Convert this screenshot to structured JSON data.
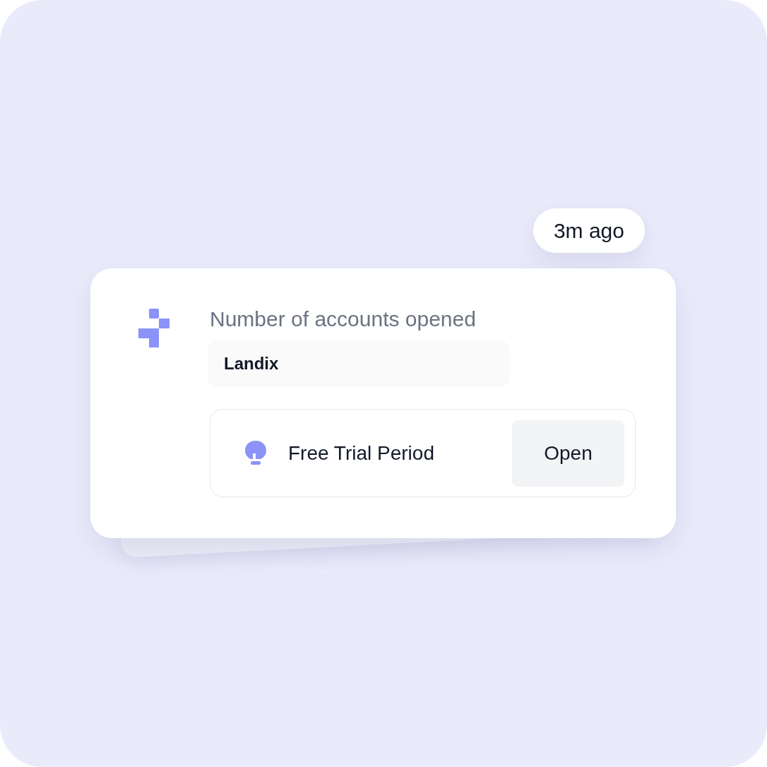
{
  "time_badge": "3m ago",
  "card": {
    "title": "Number of accounts opened",
    "field_value": "Landix",
    "trial": {
      "label": "Free Trial Period",
      "button": "Open"
    }
  }
}
